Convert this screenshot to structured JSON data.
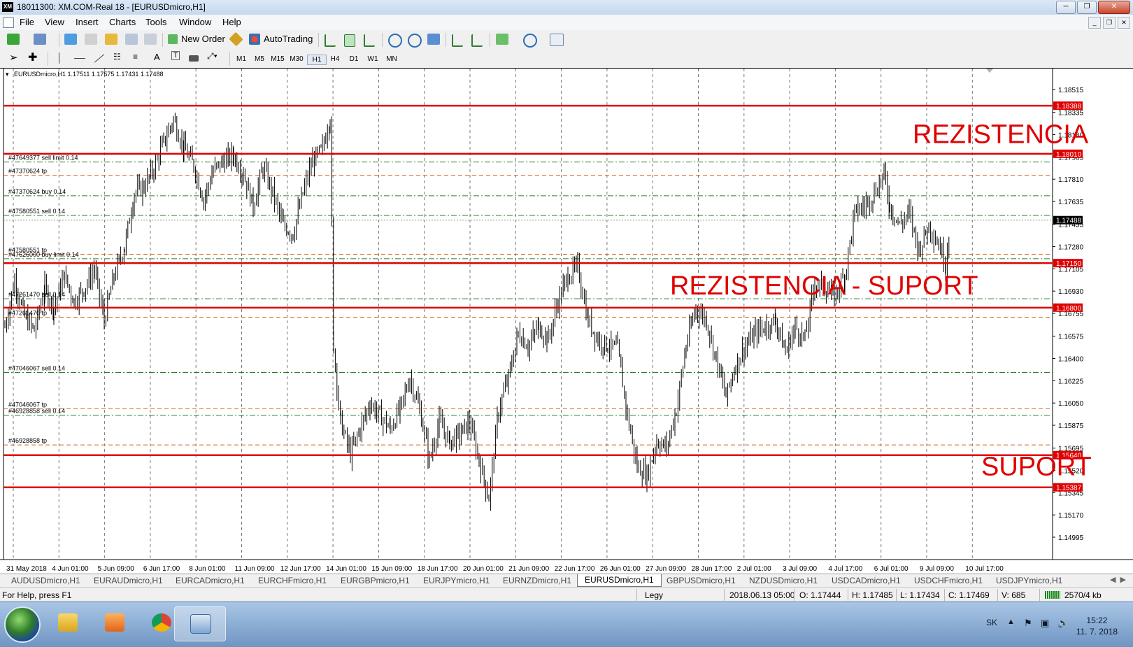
{
  "window": {
    "title": "18011300: XM.COM-Real 18 - [EURUSDmicro,H1]",
    "icon": "XM"
  },
  "menu": [
    "File",
    "View",
    "Insert",
    "Charts",
    "Tools",
    "Window",
    "Help"
  ],
  "toolbar": {
    "new_order": "New Order",
    "auto_trading": "AutoTrading"
  },
  "timeframes": [
    "M1",
    "M5",
    "M15",
    "M30",
    "H1",
    "H4",
    "D1",
    "W1",
    "MN"
  ],
  "active_timeframe": "H1",
  "chart_info": "EURUSDmicro,H1  1.17511 1.17575 1.17431 1.17488",
  "chart_data": {
    "type": "bar",
    "symbol": "EURUSDmicro",
    "timeframe": "H1",
    "ohlc": {
      "open": 1.17511,
      "high": 1.17575,
      "low": 1.17431,
      "close": 1.17488
    },
    "current_price": "1.17488",
    "ylim": [
      1.14995,
      1.18515
    ],
    "y_ticks": [
      "1.18515",
      "1.18335",
      "1.18160",
      "1.17985",
      "1.17810",
      "1.17635",
      "1.17455",
      "1.17280",
      "1.17105",
      "1.16930",
      "1.16755",
      "1.16575",
      "1.16400",
      "1.16225",
      "1.16050",
      "1.15875",
      "1.15695",
      "1.15520",
      "1.15345",
      "1.15170",
      "1.14995"
    ],
    "x_ticks": [
      "31 May 2018",
      "4 Jun 01:00",
      "5 Jun 09:00",
      "6 Jun 17:00",
      "8 Jun 01:00",
      "11 Jun 09:00",
      "12 Jun 17:00",
      "14 Jun 01:00",
      "15 Jun 09:00",
      "18 Jun 17:00",
      "20 Jun 01:00",
      "21 Jun 09:00",
      "22 Jun 17:00",
      "26 Jun 01:00",
      "27 Jun 09:00",
      "28 Jun 17:00",
      "2 Jul 01:00",
      "3 Jul 09:00",
      "4 Jul 17:00",
      "6 Jul 01:00",
      "9 Jul 09:00",
      "10 Jul 17:00"
    ],
    "price_path": [
      [
        0,
        1.1665
      ],
      [
        14,
        1.1702
      ],
      [
        28,
        1.1673
      ],
      [
        42,
        1.1662
      ],
      [
        57,
        1.1695
      ],
      [
        70,
        1.168
      ],
      [
        85,
        1.1705
      ],
      [
        99,
        1.1685
      ],
      [
        113,
        1.1695
      ],
      [
        128,
        1.171
      ],
      [
        142,
        1.167
      ],
      [
        156,
        1.1705
      ],
      [
        171,
        1.1728
      ],
      [
        185,
        1.177
      ],
      [
        199,
        1.1775
      ],
      [
        213,
        1.179
      ],
      [
        227,
        1.181
      ],
      [
        241,
        1.1828
      ],
      [
        256,
        1.1805
      ],
      [
        270,
        1.1792
      ],
      [
        284,
        1.1765
      ],
      [
        298,
        1.1788
      ],
      [
        312,
        1.1795
      ],
      [
        327,
        1.18
      ],
      [
        341,
        1.1785
      ],
      [
        355,
        1.176
      ],
      [
        369,
        1.179
      ],
      [
        383,
        1.177
      ],
      [
        398,
        1.1745
      ],
      [
        412,
        1.1738
      ],
      [
        426,
        1.177
      ],
      [
        440,
        1.1795
      ],
      [
        454,
        1.1805
      ],
      [
        465,
        1.183
      ],
      [
        470,
        1.165
      ],
      [
        480,
        1.159
      ],
      [
        494,
        1.1565
      ],
      [
        508,
        1.1585
      ],
      [
        522,
        1.1605
      ],
      [
        536,
        1.1595
      ],
      [
        551,
        1.1585
      ],
      [
        565,
        1.16
      ],
      [
        579,
        1.1625
      ],
      [
        593,
        1.16
      ],
      [
        607,
        1.156
      ],
      [
        621,
        1.159
      ],
      [
        636,
        1.1575
      ],
      [
        650,
        1.158
      ],
      [
        664,
        1.159
      ],
      [
        678,
        1.156
      ],
      [
        692,
        1.153
      ],
      [
        706,
        1.16
      ],
      [
        720,
        1.1625
      ],
      [
        734,
        1.166
      ],
      [
        748,
        1.165
      ],
      [
        763,
        1.1665
      ],
      [
        777,
        1.1655
      ],
      [
        791,
        1.1685
      ],
      [
        805,
        1.1705
      ],
      [
        819,
        1.1712
      ],
      [
        834,
        1.167
      ],
      [
        848,
        1.1655
      ],
      [
        862,
        1.165
      ],
      [
        876,
        1.1648
      ],
      [
        890,
        1.1595
      ],
      [
        904,
        1.1555
      ],
      [
        918,
        1.1548
      ],
      [
        932,
        1.1575
      ],
      [
        946,
        1.157
      ],
      [
        960,
        1.16
      ],
      [
        974,
        1.165
      ],
      [
        988,
        1.168
      ],
      [
        1003,
        1.167
      ],
      [
        1017,
        1.164
      ],
      [
        1031,
        1.161
      ],
      [
        1045,
        1.1635
      ],
      [
        1059,
        1.165
      ],
      [
        1073,
        1.166
      ],
      [
        1087,
        1.1665
      ],
      [
        1102,
        1.167
      ],
      [
        1116,
        1.1645
      ],
      [
        1130,
        1.1665
      ],
      [
        1144,
        1.1655
      ],
      [
        1158,
        1.17
      ],
      [
        1172,
        1.1695
      ],
      [
        1186,
        1.169
      ],
      [
        1201,
        1.1705
      ],
      [
        1215,
        1.1755
      ],
      [
        1229,
        1.176
      ],
      [
        1243,
        1.177
      ],
      [
        1257,
        1.1785
      ],
      [
        1265,
        1.176
      ],
      [
        1279,
        1.1745
      ],
      [
        1293,
        1.1755
      ],
      [
        1307,
        1.1725
      ],
      [
        1321,
        1.1745
      ],
      [
        1335,
        1.173
      ],
      [
        1345,
        1.1715
      ],
      [
        1352,
        1.1749
      ]
    ],
    "levels": [
      {
        "price": "1.18388",
        "value": 1.18388
      },
      {
        "price": "1.18010",
        "value": 1.1801
      },
      {
        "price": "1.17150",
        "value": 1.1715
      },
      {
        "price": "1.16800",
        "value": 1.168
      },
      {
        "price": "1.15640",
        "value": 1.1564
      },
      {
        "price": "1.15387",
        "value": 1.15387
      }
    ],
    "orders": [
      {
        "label": "#47649377 sell limit 0.14",
        "value": 1.17945,
        "kind": "entry"
      },
      {
        "label": "#47370624 tp",
        "value": 1.1784,
        "kind": "tp"
      },
      {
        "label": "#47370624 buy 0.14",
        "value": 1.1768,
        "kind": "entry"
      },
      {
        "label": "#47580551 sell 0.14",
        "value": 1.17525,
        "kind": "entry"
      },
      {
        "label": "#47580551 tp",
        "value": 1.1722,
        "kind": "tp"
      },
      {
        "label": "#47626000 buy limit 0.14",
        "value": 1.17185,
        "kind": "entry"
      },
      {
        "label": "#47261470 sell 0.14",
        "value": 1.1687,
        "kind": "entry"
      },
      {
        "label": "#47261470 tp",
        "value": 1.16725,
        "kind": "tp"
      },
      {
        "label": "#47046067 sell 0.14",
        "value": 1.1629,
        "kind": "entry"
      },
      {
        "label": "#47046067 tp",
        "value": 1.16005,
        "kind": "tp"
      },
      {
        "label": "#46928858 sell 0.14",
        "value": 1.15955,
        "kind": "entry"
      },
      {
        "label": "#46928858 tp",
        "value": 1.1572,
        "kind": "tp"
      }
    ],
    "annotations": [
      "REZISTENCIA",
      "REZISTENCIA - SUPORT",
      "SUPORT"
    ],
    "colors": {
      "level": "#e00000",
      "annotation": "#e00000",
      "candle": "#000000",
      "entry_line": "#2e7d32",
      "tp_line": "#d2691e",
      "grid": "#777777"
    }
  },
  "tabs": [
    "AUDUSDmicro,H1",
    "EURAUDmicro,H1",
    "EURCADmicro,H1",
    "EURCHFmicro,H1",
    "EURGBPmicro,H1",
    "EURJPYmicro,H1",
    "EURNZDmicro,H1",
    "EURUSDmicro,H1",
    "GBPUSDmicro,H1",
    "NZDUSDmicro,H1",
    "USDCADmicro,H1",
    "USDCHFmicro,H1",
    "USDJPYmicro,H1"
  ],
  "active_tab": "EURUSDmicro,H1",
  "status": {
    "help": "For Help, press F1",
    "profile": "Legy",
    "datetime": "2018.06.13 05:00",
    "open": "O: 1.17444",
    "high": "H: 1.17485",
    "low": "L: 1.17434",
    "close": "C: 1.17469",
    "volume": "V: 685",
    "traffic": "2570/4 kb"
  },
  "taskbar": {
    "lang": "SK",
    "time": "15:22",
    "date": "11. 7. 2018"
  }
}
